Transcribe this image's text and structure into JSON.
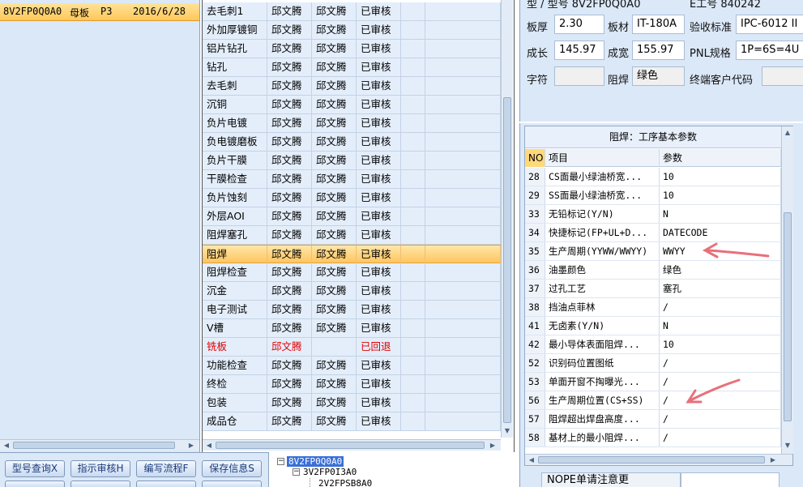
{
  "order_list": {
    "selected_row": {
      "code": "8V2FP0Q0A0",
      "type": "母板",
      "level": "P3",
      "date": "2016/6/28"
    }
  },
  "process_rows": [
    {
      "name": "去毛刺1",
      "user1": "邱文腾",
      "user2": "邱文腾",
      "status": "已审核"
    },
    {
      "name": "外加厚镀铜",
      "user1": "邱文腾",
      "user2": "邱文腾",
      "status": "已审核"
    },
    {
      "name": "铝片钻孔",
      "user1": "邱文腾",
      "user2": "邱文腾",
      "status": "已审核"
    },
    {
      "name": "钻孔",
      "user1": "邱文腾",
      "user2": "邱文腾",
      "status": "已审核"
    },
    {
      "name": "去毛刺",
      "user1": "邱文腾",
      "user2": "邱文腾",
      "status": "已审核"
    },
    {
      "name": "沉铜",
      "user1": "邱文腾",
      "user2": "邱文腾",
      "status": "已审核"
    },
    {
      "name": "负片电镀",
      "user1": "邱文腾",
      "user2": "邱文腾",
      "status": "已审核"
    },
    {
      "name": "负电镀磨板",
      "user1": "邱文腾",
      "user2": "邱文腾",
      "status": "已审核"
    },
    {
      "name": "负片干膜",
      "user1": "邱文腾",
      "user2": "邱文腾",
      "status": "已审核"
    },
    {
      "name": "干膜检查",
      "user1": "邱文腾",
      "user2": "邱文腾",
      "status": "已审核"
    },
    {
      "name": "负片蚀刻",
      "user1": "邱文腾",
      "user2": "邱文腾",
      "status": "已审核"
    },
    {
      "name": "外层AOI",
      "user1": "邱文腾",
      "user2": "邱文腾",
      "status": "已审核"
    },
    {
      "name": "阻焊塞孔",
      "user1": "邱文腾",
      "user2": "邱文腾",
      "status": "已审核"
    },
    {
      "name": "阻焊",
      "user1": "邱文腾",
      "user2": "邱文腾",
      "status": "已审核"
    },
    {
      "name": "阻焊检查",
      "user1": "邱文腾",
      "user2": "邱文腾",
      "status": "已审核"
    },
    {
      "name": "沉金",
      "user1": "邱文腾",
      "user2": "邱文腾",
      "status": "已审核"
    },
    {
      "name": "电子测试",
      "user1": "邱文腾",
      "user2": "邱文腾",
      "status": "已审核"
    },
    {
      "name": "V槽",
      "user1": "邱文腾",
      "user2": "邱文腾",
      "status": "已审核"
    },
    {
      "name": "铣板",
      "user1": "邱文腾",
      "user2": "",
      "status": "已回退"
    },
    {
      "name": "功能检查",
      "user1": "邱文腾",
      "user2": "邱文腾",
      "status": "已审核"
    },
    {
      "name": "终检",
      "user1": "邱文腾",
      "user2": "邱文腾",
      "status": "已审核"
    },
    {
      "name": "包装",
      "user1": "邱文腾",
      "user2": "邱文腾",
      "status": "已审核"
    },
    {
      "name": "成品仓",
      "user1": "邱文腾",
      "user2": "邱文腾",
      "status": "已审核"
    }
  ],
  "buttons": {
    "model_query": "型号查询X",
    "instr_review": "指示审核H",
    "edit_flow": "编写流程F",
    "save_info": "保存信息S"
  },
  "tree": {
    "root": "8V2FP0Q0A0",
    "child": "3V2FP0I3A0",
    "grandchild": "2V2FPSB8A0",
    "collapse_glyph": "−"
  },
  "info": {
    "top_partial_1": "型 / 型号  8V2FP0Q0A0",
    "top_partial_2": "E工号  840242",
    "thickness_label": "板厚",
    "thickness_value": "2.30",
    "material_label": "板材",
    "material_value": "IT-180A",
    "standard_label": "验收标准",
    "standard_value": "IPC-6012 II",
    "length_label": "成长",
    "length_value": "145.97",
    "width_label": "成宽",
    "width_value": "155.97",
    "pnl_label": "PNL规格",
    "pnl_value": "1P=6S=4U",
    "char_label": "字符",
    "char_value": "",
    "mask_label": "阻焊",
    "mask_value": "绿色",
    "customer_label": "终端客户代码",
    "customer_value": ""
  },
  "params": {
    "title": "阻焊：工序基本参数",
    "head_no": "NO",
    "head_item": "项目",
    "head_param": "参数",
    "rows": [
      {
        "no": "28",
        "item": "CS面最小绿油桥宽...",
        "value": "10"
      },
      {
        "no": "29",
        "item": "SS面最小绿油桥宽...",
        "value": "10"
      },
      {
        "no": "33",
        "item": "无铅标记(Y/N)",
        "value": "N"
      },
      {
        "no": "34",
        "item": "快捷标记(FP+UL+D...",
        "value": "DATECODE"
      },
      {
        "no": "35",
        "item": "生产周期(YYWW/WWYY)",
        "value": "WWYY"
      },
      {
        "no": "36",
        "item": "油墨颜色",
        "value": "绿色"
      },
      {
        "no": "37",
        "item": "过孔工艺",
        "value": "塞孔"
      },
      {
        "no": "38",
        "item": "挡油点菲林",
        "value": "/"
      },
      {
        "no": "41",
        "item": "无卤素(Y/N)",
        "value": "N"
      },
      {
        "no": "42",
        "item": "最小导体表面阻焊...",
        "value": "10"
      },
      {
        "no": "52",
        "item": "识别码位置图纸",
        "value": "/"
      },
      {
        "no": "53",
        "item": "单面开窗不掏曝光...",
        "value": "/"
      },
      {
        "no": "56",
        "item": "生产周期位置(CS+SS)",
        "value": "/"
      },
      {
        "no": "57",
        "item": "阻焊超出焊盘高度...",
        "value": "/"
      },
      {
        "no": "58",
        "item": "基材上的最小阻焊...",
        "value": "/"
      }
    ]
  },
  "note": {
    "label": "NOPE单请注意更"
  },
  "colors": {
    "accent_orange": "#ffc560",
    "panel_blue": "#dbe8f8",
    "arrow_red": "#e8707a",
    "rejected_red": "#e00000"
  }
}
